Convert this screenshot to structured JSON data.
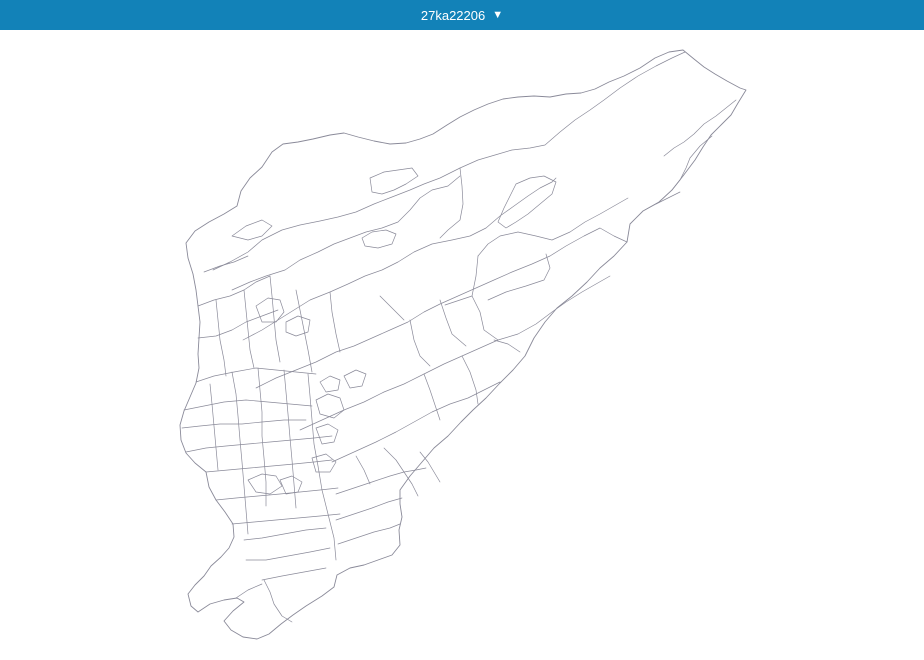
{
  "header": {
    "title": "27ka22206",
    "dropdown_icon": "triangle-down-icon",
    "background_color": "#1282b8",
    "text_color": "#ffffff"
  },
  "map": {
    "stroke_color": "#8a8a99",
    "fill_color": "#ffffff"
  }
}
